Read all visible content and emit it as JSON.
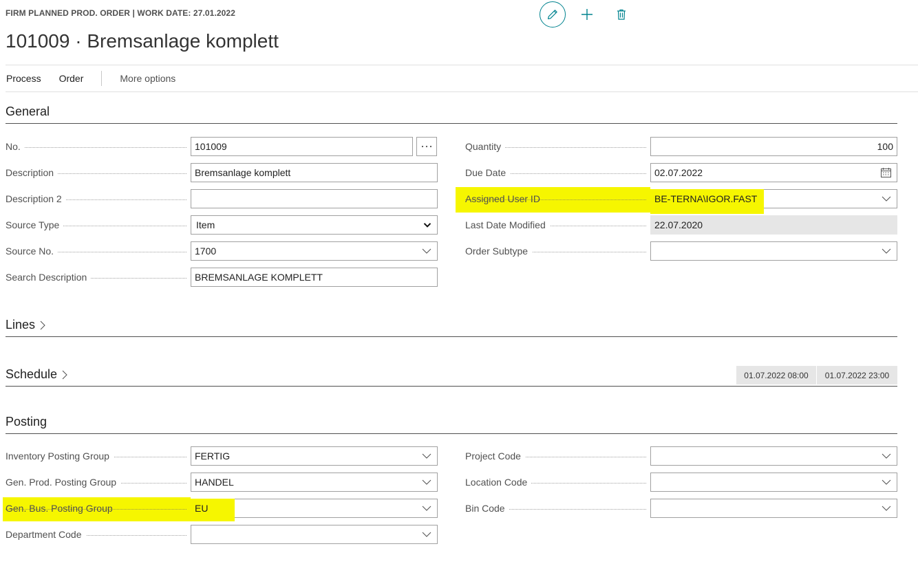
{
  "header": {
    "caption": "FIRM PLANNED PROD. ORDER | WORK DATE: 27.01.2022",
    "title": "101009 · Bremsanlage komplett",
    "edit_icon": "pencil-icon",
    "new_icon": "plus-icon",
    "delete_icon": "trash-icon"
  },
  "actionbar": {
    "process": "Process",
    "order": "Order",
    "more": "More options"
  },
  "sections": {
    "general": "General",
    "lines": "Lines",
    "schedule": "Schedule",
    "posting": "Posting"
  },
  "general": {
    "no": {
      "label": "No.",
      "value": "101009"
    },
    "description": {
      "label": "Description",
      "value": "Bremsanlage komplett"
    },
    "description2": {
      "label": "Description 2",
      "value": ""
    },
    "source_type": {
      "label": "Source Type",
      "value": "Item"
    },
    "source_no": {
      "label": "Source No.",
      "value": "1700"
    },
    "search_description": {
      "label": "Search Description",
      "value": "BREMSANLAGE KOMPLETT"
    },
    "quantity": {
      "label": "Quantity",
      "value": "100"
    },
    "due_date": {
      "label": "Due Date",
      "value": "02.07.2022"
    },
    "assigned_user": {
      "label": "Assigned User ID",
      "value": "BE-TERNA\\IGOR.FAST"
    },
    "last_modified": {
      "label": "Last Date Modified",
      "value": "22.07.2020"
    },
    "order_subtype": {
      "label": "Order Subtype",
      "value": ""
    }
  },
  "schedule": {
    "starting": "01.07.2022 08:00",
    "ending": "01.07.2022 23:00"
  },
  "posting": {
    "inventory_pg": {
      "label": "Inventory Posting Group",
      "value": "FERTIG"
    },
    "gen_prod_pg": {
      "label": "Gen. Prod. Posting Group",
      "value": "HANDEL"
    },
    "gen_bus_pg": {
      "label": "Gen. Bus. Posting Group",
      "value": "EU"
    },
    "department": {
      "label": "Department Code",
      "value": ""
    },
    "project": {
      "label": "Project Code",
      "value": ""
    },
    "location": {
      "label": "Location Code",
      "value": ""
    },
    "bin": {
      "label": "Bin Code",
      "value": ""
    }
  },
  "colors": {
    "accent": "#00838f",
    "highlight": "#f6f600"
  }
}
